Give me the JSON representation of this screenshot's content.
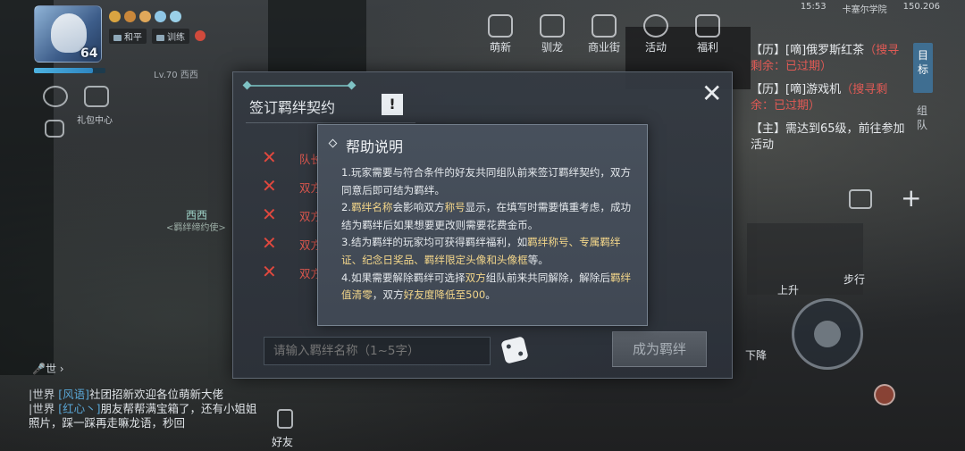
{
  "status": {
    "time": "15:53",
    "location": "卡塞尔学院",
    "ping": "150.206"
  },
  "player": {
    "level": "64",
    "hp_fraction": 0.82,
    "chips": [
      {
        "label": "和平"
      },
      {
        "label": "训练"
      }
    ],
    "char_tag": "Lv.70 西西",
    "gift_label": "礼包中心"
  },
  "topnav": [
    {
      "label": "萌新",
      "icon": "newbie-gift-icon"
    },
    {
      "label": "驯龙",
      "icon": "dragon-icon"
    },
    {
      "label": "商业街",
      "icon": "shop-icon"
    },
    {
      "label": "活动",
      "icon": "event-icon"
    },
    {
      "label": "福利",
      "icon": "welfare-icon"
    }
  ],
  "quests": [
    {
      "tag": "【历】",
      "prefix": "[嘀]",
      "name": "俄罗斯红茶",
      "status": "（搜寻剩余：已过期）"
    },
    {
      "tag": "【历】",
      "prefix": "[嘀]",
      "name": "游戏机",
      "status": "（搜寻剩余：已过期）"
    },
    {
      "tag": "【主】",
      "prefix": "",
      "name": "需达到65级，前往参加活动",
      "status": ""
    }
  ],
  "quest_tabs": {
    "target": "目标",
    "team": "组队"
  },
  "controls": {
    "up": "上升",
    "walk": "步行",
    "down": "下降"
  },
  "npc": {
    "name": "西西",
    "title": "<羁绊缔约使>"
  },
  "chat": {
    "voice": "世",
    "lines": [
      {
        "channel": "|世界",
        "name": "[风语]",
        "text": "社团招新欢迎各位萌新大佬"
      },
      {
        "channel": "|世界",
        "name": "[红心丶]",
        "text": "朋友帮帮满宝箱了，还有小姐姐照片，踩一踩再走嘛龙语，秒回"
      }
    ],
    "friends_label": "好友"
  },
  "dialog": {
    "title": "签订羁绊契约",
    "help_button": "!",
    "close": "✕",
    "requirements": [
      {
        "text": "队长"
      },
      {
        "text": "双方"
      },
      {
        "text": "双方"
      },
      {
        "text": "双方"
      },
      {
        "text": "双方"
      }
    ],
    "input_placeholder": "请输入羁绊名称（1~5字）",
    "confirm_label": "成为羁绊"
  },
  "help": {
    "title": "帮助说明",
    "p1": "1.玩家需要与符合条件的好友共同组队前来签订羁绊契约，双方同意后即可结为羁绊。",
    "p2a": "2.",
    "p2b": "羁绊名称",
    "p2c": "会影响双方",
    "p2d": "称号",
    "p2e": "显示，在填写时需要慎重考虑，成功结为羁绊后如果想要更改则需要花费金币。",
    "p3a": "3.结为羁绊的玩家均可获得羁绊福利，如",
    "p3b": "羁绊称号、专属羁绊证、纪念日奖品、羁绊限定头像和头像框",
    "p3c": "等。",
    "p4a": "4.如果需要解除羁绊可选择",
    "p4b": "双方",
    "p4c": "组队前来共同解除，解除后",
    "p4d": "羁绊值清零",
    "p4e": "，双方",
    "p4f": "好友度降低至500",
    "p4g": "。"
  },
  "colors": {
    "accent": "#3f6e91",
    "warning": "#e0483e",
    "highlight": "#f3d68a"
  }
}
